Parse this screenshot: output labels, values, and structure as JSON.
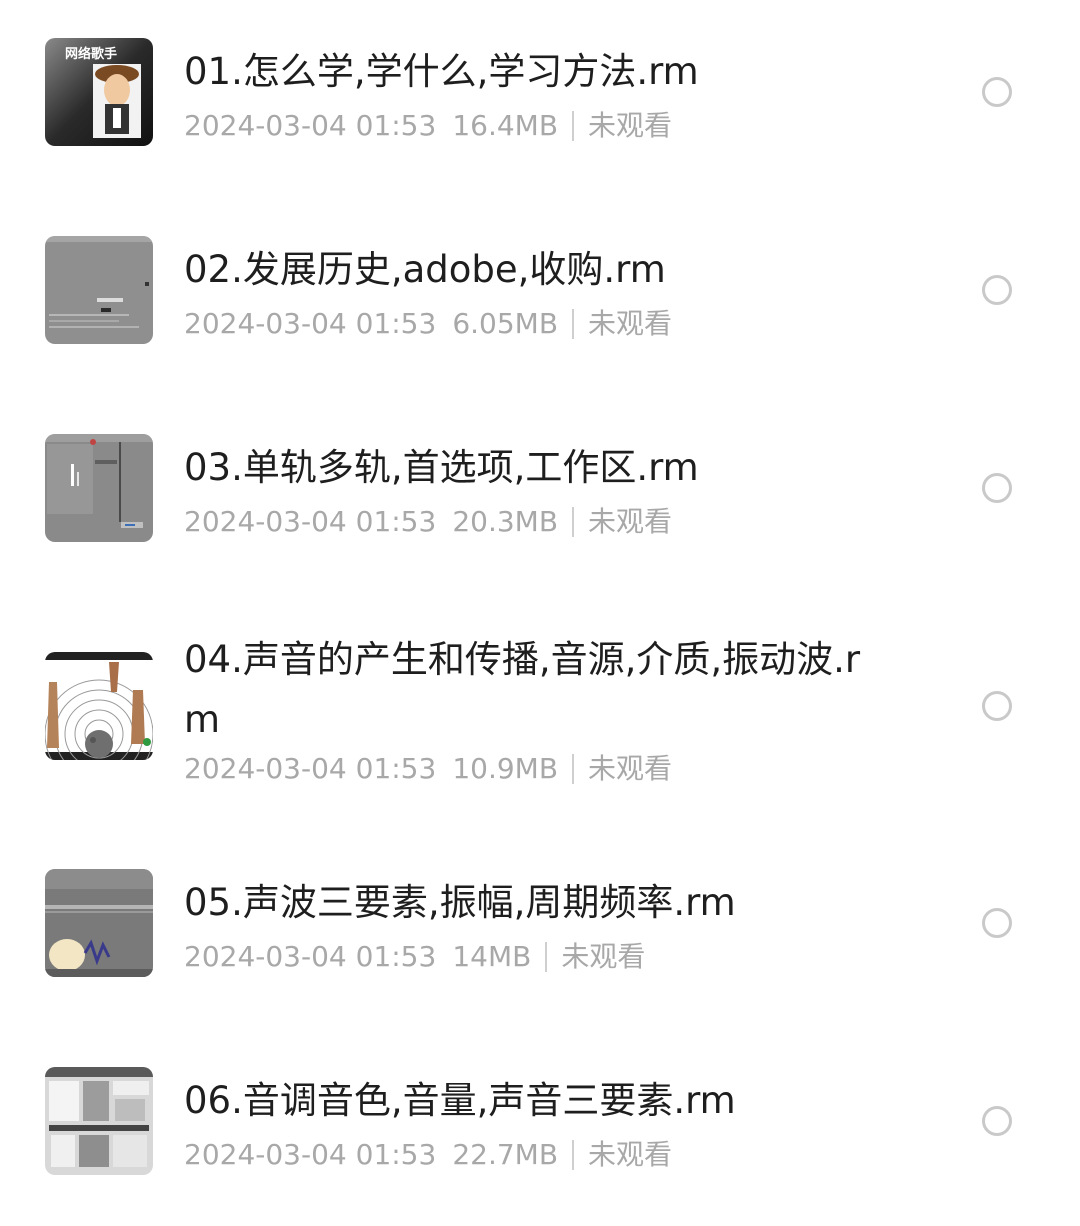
{
  "files": [
    {
      "title": "01.怎么学,学什么,学习方法.rm",
      "date": "2024-03-04 01:53",
      "size": "16.4MB",
      "status": "未观看",
      "thumbnail_text": "网络歌手"
    },
    {
      "title": "02.发展历史,adobe,收购.rm",
      "date": "2024-03-04 01:53",
      "size": "6.05MB",
      "status": "未观看"
    },
    {
      "title": "03.单轨多轨,首选项,工作区.rm",
      "date": "2024-03-04 01:53",
      "size": "20.3MB",
      "status": "未观看"
    },
    {
      "title": "04.声音的产生和传播,音源,介质,振动波.rm",
      "date": "2024-03-04 01:53",
      "size": "10.9MB",
      "status": "未观看"
    },
    {
      "title": "05.声波三要素,振幅,周期频率.rm",
      "date": "2024-03-04 01:53",
      "size": "14MB",
      "status": "未观看"
    },
    {
      "title": "06.音调音色,音量,声音三要素.rm",
      "date": "2024-03-04 01:53",
      "size": "22.7MB",
      "status": "未观看"
    }
  ]
}
